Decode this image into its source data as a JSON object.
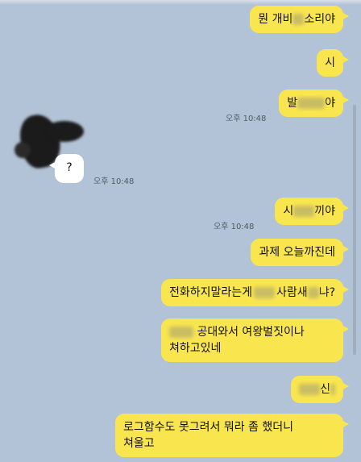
{
  "messages": {
    "m1": {
      "before": "뭔 개비",
      "after": "소리야"
    },
    "m2": {
      "text": "시"
    },
    "m3": {
      "before": "발",
      "after": "야"
    },
    "t1": "오후 10:48",
    "q": {
      "text": "?"
    },
    "t2": "오후 10:48",
    "m4": {
      "before": "시",
      "after": "끼야"
    },
    "t3": "오후 10:48",
    "m5": {
      "text": "과제 오늘까진데"
    },
    "m6": {
      "before": "전화하지말라는게",
      "mid": "사람새",
      "after": "냐?"
    },
    "m7": {
      "line1_after": "공대와서 여왕벌짓이나",
      "line2": "쳐하고있네"
    },
    "m8": {
      "after": "신"
    },
    "m9": {
      "line1": "로그함수도 못그려서 뭐라 좀 했더니",
      "line2": "쳐울고"
    }
  },
  "colors": {
    "background": "#b3c3d7",
    "my_bubble": "#f9e64f",
    "their_bubble": "#ffffff",
    "timestamp": "#4f5a66"
  }
}
